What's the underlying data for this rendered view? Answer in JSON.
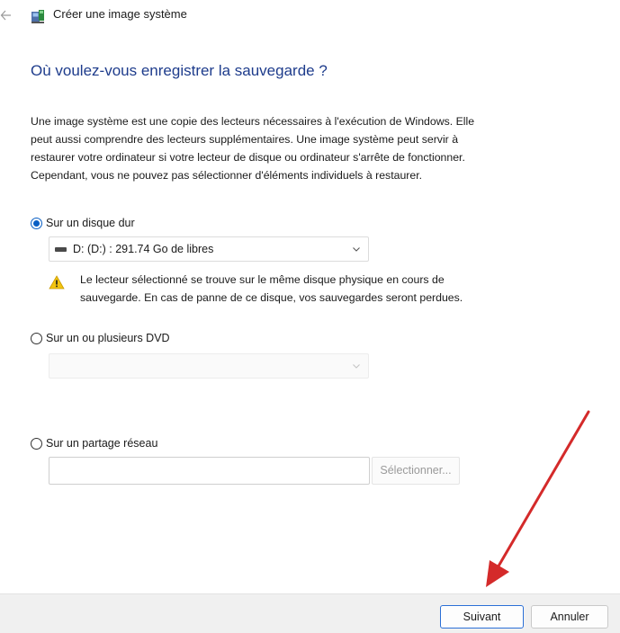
{
  "window": {
    "title": "Créer une image système",
    "icons": {
      "back": "back-arrow-icon",
      "app": "system-image-icon"
    }
  },
  "main": {
    "heading": "Où voulez-vous enregistrer la sauvegarde ?",
    "description": [
      "Une image système est une copie des lecteurs nécessaires à l'exécution de Windows. Elle",
      "peut aussi comprendre des lecteurs supplémentaires. Une image système peut servir à",
      "restaurer votre ordinateur si votre lecteur de disque ou ordinateur s'arrête de fonctionner.",
      "Cependant, vous ne pouvez pas sélectionner d'éléments individuels à restaurer."
    ]
  },
  "options": {
    "hard_disk": {
      "label": "Sur un disque dur",
      "checked": true,
      "selected_drive": "D: (D:) : 291.74 Go de libres",
      "warning": [
        "Le lecteur sélectionné se trouve sur le même disque physique en cours de",
        "sauvegarde. En cas de panne de ce disque, vos sauvegardes seront perdues."
      ]
    },
    "dvd": {
      "label": "Sur un ou plusieurs DVD",
      "checked": false,
      "selected_drive": ""
    },
    "network": {
      "label": "Sur un partage réseau",
      "checked": false,
      "path_value": "",
      "select_button": "Sélectionner..."
    }
  },
  "footer": {
    "next_label": "Suivant",
    "cancel_label": "Annuler"
  },
  "colors": {
    "heading": "#1e3c8c",
    "accent": "#0a5fc4",
    "annotation_arrow": "#d42a2a",
    "warning": "#f2c40f",
    "footer_bg": "#f0f0f0"
  }
}
